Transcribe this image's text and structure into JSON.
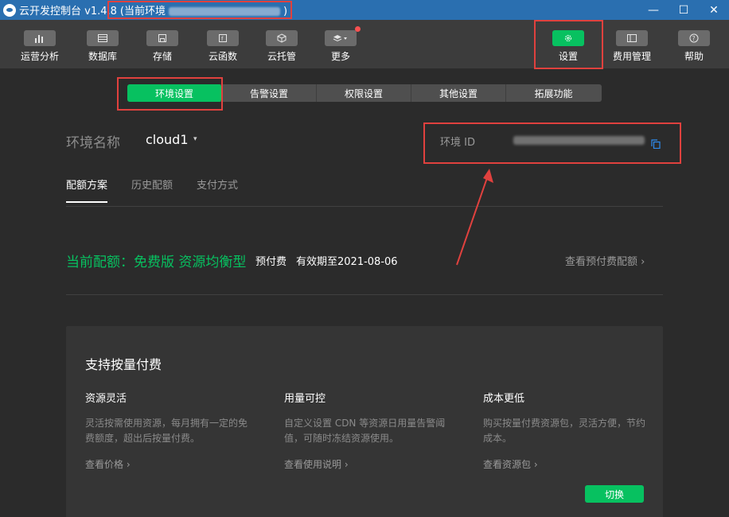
{
  "titlebar": {
    "app_title": "云开发控制台 v1.4.8",
    "env_prefix": "(当前环境",
    "env_suffix": ")",
    "minimize": "—",
    "maximize": "☐",
    "close": "✕"
  },
  "toolbar": {
    "items": [
      {
        "label": "运营分析",
        "icon": "bar-chart-icon"
      },
      {
        "label": "数据库",
        "icon": "database-icon"
      },
      {
        "label": "存储",
        "icon": "save-icon"
      },
      {
        "label": "云函数",
        "icon": "function-icon"
      },
      {
        "label": "云托管",
        "icon": "cube-icon"
      },
      {
        "label": "更多",
        "icon": "layers-icon"
      },
      {
        "label": "设置",
        "icon": "gear-icon"
      },
      {
        "label": "费用管理",
        "icon": "billing-icon"
      },
      {
        "label": "帮助",
        "icon": "help-icon"
      }
    ]
  },
  "settings_tabs": [
    "环境设置",
    "告警设置",
    "权限设置",
    "其他设置",
    "拓展功能"
  ],
  "environment": {
    "name_label": "环境名称",
    "name_value": "cloud1",
    "caret": "▾",
    "id_label": "环境 ID"
  },
  "subtabs": [
    "配额方案",
    "历史配额",
    "支付方式"
  ],
  "quota": {
    "current": "当前配额：免费版 资源均衡型",
    "pay_type": "预付费",
    "expire": "有效期至2021-08-06",
    "link": "查看预付费配额 ›"
  },
  "card": {
    "title": "支持按量付费",
    "features": [
      {
        "title": "资源灵活",
        "desc": "灵活按需使用资源，每月拥有一定的免费额度，超出后按量付费。",
        "link": "查看价格 ›"
      },
      {
        "title": "用量可控",
        "desc": "自定义设置 CDN 等资源日用量告警阈值，可随时冻结资源使用。",
        "link": "查看使用说明 ›"
      },
      {
        "title": "成本更低",
        "desc": "购买按量付费资源包，灵活方便，节约成本。",
        "link": "查看资源包 ›"
      }
    ],
    "switch_label": "切换"
  },
  "colors": {
    "accent": "#07c160",
    "annotation": "#e0413e",
    "titlebar": "#2a6fb0"
  }
}
